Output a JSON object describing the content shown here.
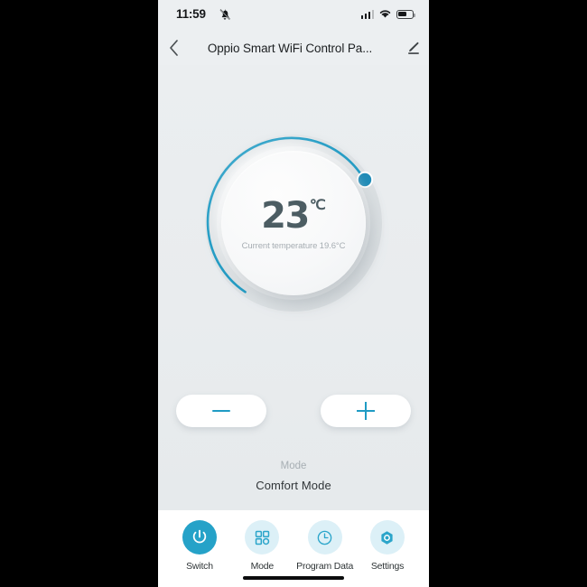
{
  "status_bar": {
    "time": "11:59",
    "mute_icon": "bell-slash-icon",
    "signal_icon": "cellular-signal-icon",
    "signal_bars_filled": 3,
    "signal_bars_total": 4,
    "wifi_icon": "wifi-icon",
    "battery_icon": "battery-icon",
    "battery_percent": 62
  },
  "header": {
    "back_icon": "chevron-left-icon",
    "title": "Oppio Smart WiFi Control Pa...",
    "edit_icon": "pencil-edit-icon"
  },
  "dial": {
    "target_temperature": "23",
    "unit": "℃",
    "current_temperature_text": "Current temperature 19.6°C",
    "knob_icon": "dial-knob-handle",
    "arc_color": "#1f9bc4",
    "track_color": "#dde2e5"
  },
  "controls": {
    "decrease_label": "−",
    "decrease_icon": "minus-icon",
    "increase_label": "+",
    "increase_icon": "plus-icon",
    "accent_color": "#1f9bc4"
  },
  "mode": {
    "label": "Mode",
    "value": "Comfort  Mode"
  },
  "nav": {
    "items": [
      {
        "label": "Switch",
        "icon": "power-icon",
        "active": true
      },
      {
        "label": "Mode",
        "icon": "grid-icon",
        "active": false
      },
      {
        "label": "Program Data",
        "icon": "clock-icon",
        "active": false
      },
      {
        "label": "Settings",
        "icon": "hex-nut-icon",
        "active": false
      }
    ],
    "active_bg": "#25a2c8",
    "inactive_bg": "#dcf0f7",
    "home_indicator": "home-indicator-bar"
  }
}
